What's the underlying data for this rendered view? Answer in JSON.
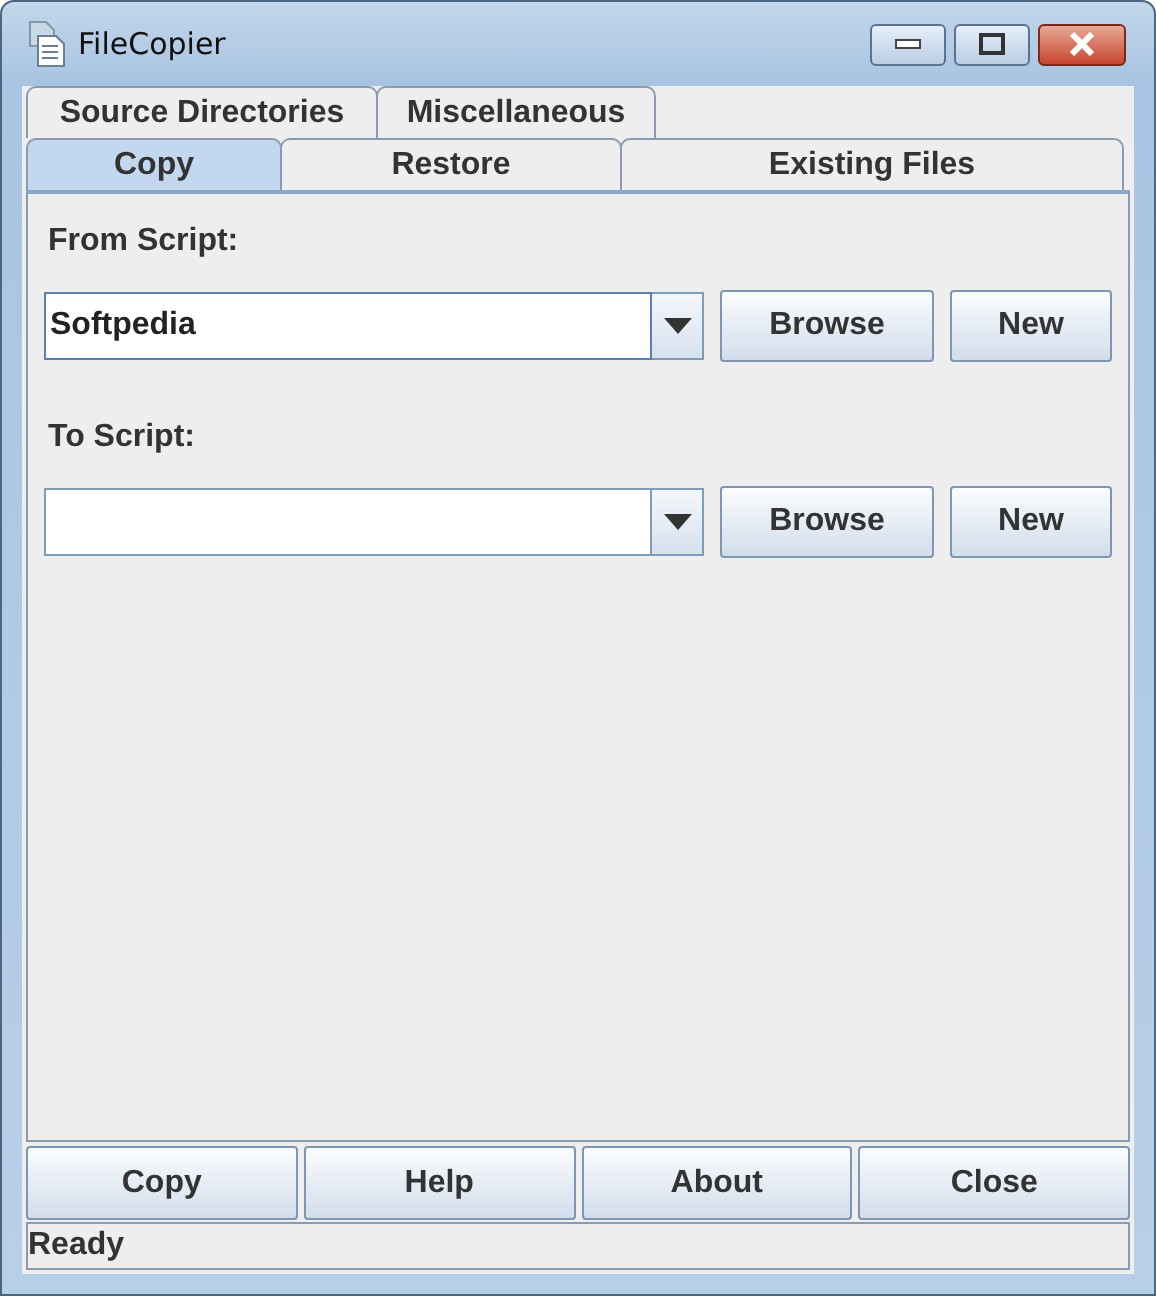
{
  "window": {
    "title": "FileCopier"
  },
  "tab_rows": [
    [
      {
        "label": "Source Directories",
        "selected": false
      },
      {
        "label": "Miscellaneous",
        "selected": false
      }
    ],
    [
      {
        "label": "Copy",
        "selected": true
      },
      {
        "label": "Restore",
        "selected": false
      },
      {
        "label": "Existing Files",
        "selected": false
      }
    ]
  ],
  "script_rows": [
    {
      "label": "From Script:",
      "value": "Softpedia",
      "focused": true,
      "buttons": [
        "Browse",
        "New"
      ]
    },
    {
      "label": "To Script:",
      "value": "",
      "focused": false,
      "buttons": [
        "Browse",
        "New"
      ]
    }
  ],
  "bottom_buttons": [
    "Copy",
    "Help",
    "About",
    "Close"
  ],
  "status_bar": "Ready"
}
